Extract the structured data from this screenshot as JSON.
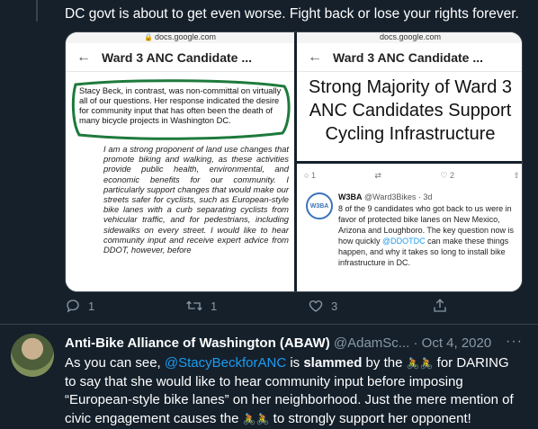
{
  "top_tweet": {
    "text": "DC govt is about to get even worse. Fight back or lose your rights forever."
  },
  "media": {
    "left": {
      "url": "docs.google.com",
      "title": "Ward 3 ANC Candidate ...",
      "quote": "Stacy Beck, in contrast, was non-committal on virtually all of our questions. Her response indicated the desire for community input that has often been the death of many bicycle projects in Washington DC.",
      "body": "I am a strong proponent of land use changes that promote biking and walking, as these activities provide public health, environmental, and economic benefits for our community. I particularly support changes that would make our streets safer for cyclists, such as European-style bike lanes with a curb separating cyclists from vehicular traffic, and for pedestrians, including sidewalks on every street. I would like to hear community input and receive expert advice from DDOT, however, before"
    },
    "right_top": {
      "url": "docs.google.com",
      "title": "Ward 3 ANC Candidate ...",
      "headline": "Strong Majority of Ward 3 ANC Candidates Support Cycling Infrastructure"
    },
    "right_bottom": {
      "actions": {
        "reply": "1",
        "retweet": "",
        "like": "2"
      },
      "avatar_label": "W3BA",
      "name": "W3BA",
      "handle": "@Ward3Bikes · 3d",
      "body_pre": "8 of the 9 candidates who got back to us were in favor of protected bike lanes on New Mexico, Arizona and Loughboro. The key question now is how quickly ",
      "mention": "@DDOTDC",
      "body_post": " can make these things happen, and why it takes so long to install bike infrastructure in DC."
    }
  },
  "actions": {
    "reply_count": "1",
    "retweet_count": "1",
    "like_count": "3"
  },
  "tweet2": {
    "name": "Anti-Bike Alliance of Washington (ABAW)",
    "handle": "@AdamSc...",
    "dot": " · ",
    "date": "Oct 4, 2020",
    "more": "···",
    "t1": "As you can see, ",
    "mention": "@StacyBeckforANC",
    "t2": " is ",
    "bold": "slammed",
    "t3": " by the ",
    "emoji": "🚴🚴",
    "t4": " for DARING to say that she would like to hear community input before imposing “European-style bike lanes” on her neighborhood. Just the mere mention of civic engagement causes the ",
    "t5": " to strongly support her opponent!"
  },
  "colors": {
    "background": "#15202b",
    "accent": "#1d9bf0",
    "muted": "#8899a6",
    "circle": "#1e7a3c"
  }
}
